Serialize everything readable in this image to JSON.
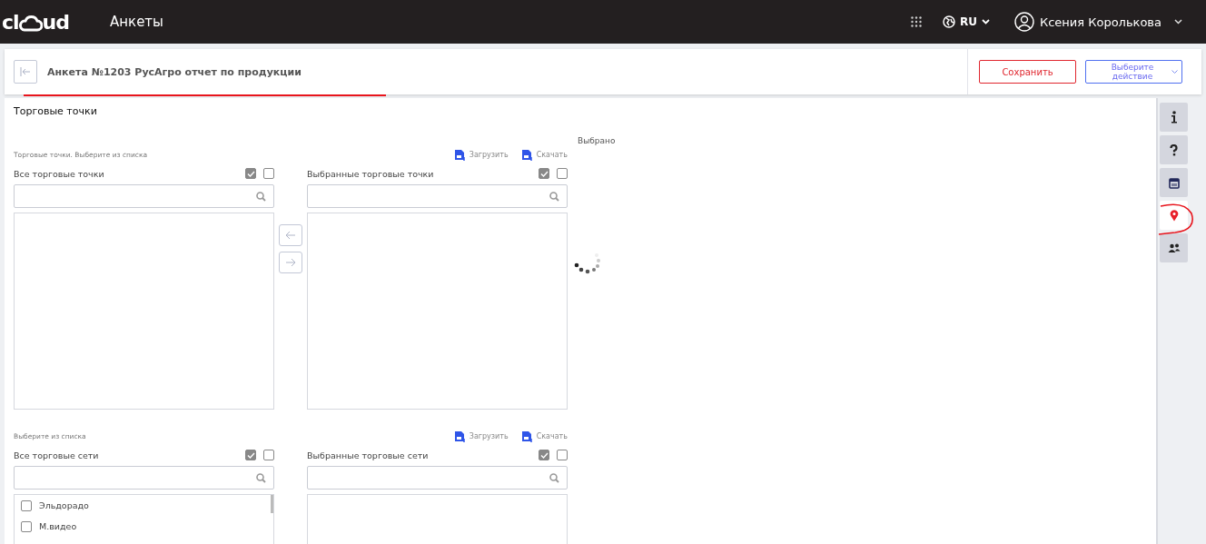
{
  "header": {
    "logo": "cl",
    "logo_end": "ud",
    "title": "Анкеты",
    "language": "RU",
    "user": "Ксения Королькова"
  },
  "form_bar": {
    "title": "Анкета №1203 РусАгро отчет по продукции",
    "save": "Сохранить",
    "action": "Выберите действие"
  },
  "panel": {
    "title": "Торговые точки",
    "selected_label": "Выбрано"
  },
  "blocks": [
    {
      "hint": "Торговые точки. Выберите из списка",
      "upload": "Загрузить",
      "download": "Скачать",
      "left": {
        "title": "Все торговые точки",
        "checks": [
          {
            "checked": true
          },
          {
            "checked": false
          }
        ]
      },
      "right": {
        "title": "Выбранные торговые точки",
        "checks": [
          {
            "checked": true
          },
          {
            "checked": false
          }
        ]
      }
    },
    {
      "hint": "Выберите из списка",
      "upload": "Загрузить",
      "download": "Скачать",
      "left": {
        "title": "Все торговые сети",
        "checks": [
          {
            "checked": true
          },
          {
            "checked": false
          }
        ],
        "items": [
          {
            "label": "Эльдорадо",
            "checked": false
          },
          {
            "label": "М.видео",
            "checked": false
          }
        ]
      },
      "right": {
        "title": "Выбранные торговые сети",
        "checks": [
          {
            "checked": true
          },
          {
            "checked": false
          }
        ]
      }
    }
  ],
  "side_tabs": [
    {
      "kind": "info",
      "selected": false
    },
    {
      "kind": "help",
      "selected": false
    },
    {
      "kind": "calendar",
      "selected": false
    },
    {
      "kind": "location",
      "selected": true
    },
    {
      "kind": "people",
      "selected": false
    }
  ]
}
